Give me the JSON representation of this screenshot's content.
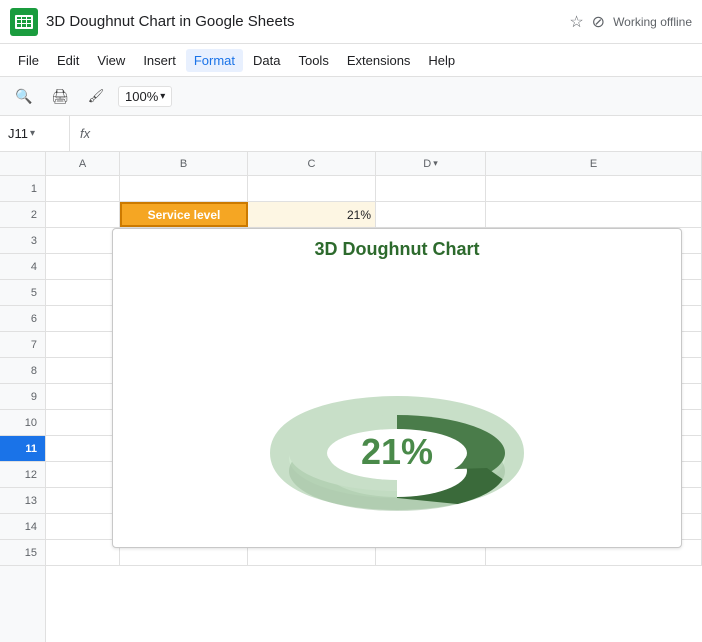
{
  "titleBar": {
    "appIcon": "google-sheets-icon",
    "title": "3D Doughnut Chart in Google Sheets",
    "offlineText": "Working offline"
  },
  "menuBar": {
    "items": [
      "File",
      "Edit",
      "View",
      "Insert",
      "Format",
      "Data",
      "Tools",
      "Extensions",
      "Help"
    ]
  },
  "toolbar": {
    "zoom": "100%"
  },
  "formulaBar": {
    "cellRef": "J11",
    "fxLabel": "fx"
  },
  "colHeaders": [
    "A",
    "B",
    "C",
    "D",
    "E"
  ],
  "rows": [
    1,
    2,
    3,
    4,
    5,
    6,
    7,
    8,
    9,
    10,
    11,
    12,
    13,
    14,
    15
  ],
  "spreadsheet": {
    "row2": {
      "colB": "Service level",
      "colC": "21%"
    }
  },
  "chart": {
    "title": "3D Doughnut Chart",
    "centerValue": "21%",
    "percentage": 21,
    "colors": {
      "filled": "#4a7c4a",
      "empty": "#c8dfc8",
      "shadow": "#8ab88a",
      "innerShadow": "#a0c8a0"
    }
  }
}
